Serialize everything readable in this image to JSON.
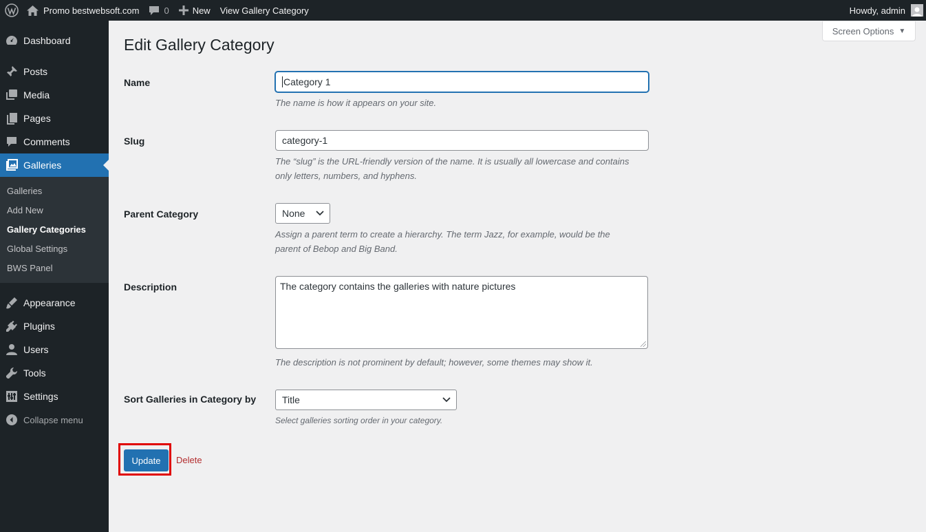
{
  "admin_bar": {
    "site_name": "Promo bestwebsoft.com",
    "comments_count": "0",
    "new_label": "New",
    "view_label": "View Gallery Category",
    "howdy": "Howdy, admin"
  },
  "sidebar": {
    "items": [
      {
        "label": "Dashboard",
        "icon": "dashboard-icon"
      },
      {
        "label": "Posts",
        "icon": "pin-icon"
      },
      {
        "label": "Media",
        "icon": "media-icon"
      },
      {
        "label": "Pages",
        "icon": "pages-icon"
      },
      {
        "label": "Comments",
        "icon": "comment-icon"
      },
      {
        "label": "Galleries",
        "icon": "gallery-icon"
      },
      {
        "label": "Appearance",
        "icon": "brush-icon"
      },
      {
        "label": "Plugins",
        "icon": "plug-icon"
      },
      {
        "label": "Users",
        "icon": "user-icon"
      },
      {
        "label": "Tools",
        "icon": "wrench-icon"
      },
      {
        "label": "Settings",
        "icon": "sliders-icon"
      }
    ],
    "submenu": [
      "Galleries",
      "Add New",
      "Gallery Categories",
      "Global Settings",
      "BWS Panel"
    ],
    "collapse": "Collapse menu"
  },
  "screen_options": "Screen Options",
  "page_title": "Edit Gallery Category",
  "form": {
    "name": {
      "label": "Name",
      "value": "Category 1",
      "desc": "The name is how it appears on your site."
    },
    "slug": {
      "label": "Slug",
      "value": "category-1",
      "desc1": "The “slug” is the URL-friendly version of the name. It is usually all lowercase and contains",
      "desc2": "only letters, numbers, and hyphens."
    },
    "parent": {
      "label": "Parent Category",
      "value": "None",
      "desc1": "Assign a parent term to create a hierarchy. The term Jazz, for example, would be the",
      "desc2": "parent of Bebop and Big Band."
    },
    "description": {
      "label": "Description",
      "value": "The category contains the galleries with nature pictures",
      "desc": "The description is not prominent by default; however, some themes may show it."
    },
    "sort": {
      "label": "Sort Galleries in Category by",
      "value": "Title",
      "desc": "Select galleries sorting order in your category."
    }
  },
  "buttons": {
    "update": "Update",
    "delete": "Delete"
  },
  "colors": {
    "accent": "#2271b1",
    "adminbar": "#1d2327",
    "highlight": "#e00000",
    "delete": "#b32d2e"
  }
}
